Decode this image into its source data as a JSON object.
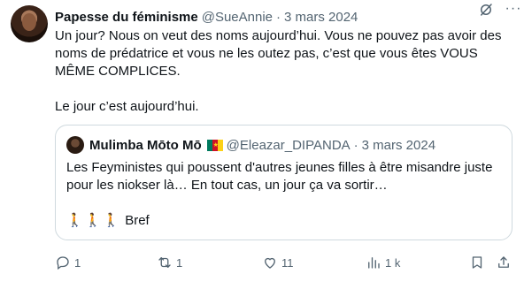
{
  "tweet": {
    "display_name": "Papesse du féminisme",
    "handle": "@SueAnnie",
    "separator": "·",
    "date": "3 mars 2024",
    "more_label": "···",
    "text_line1": "Un jour? Nous on veut des noms aujourd’hui. Vous ne pouvez pas avoir des noms de prédatrice et vous ne les outez pas, c’est que vous êtes VOUS MÊME COMPLICES.",
    "text_line2": "Le jour c’est aujourd’hui."
  },
  "quote": {
    "display_name": "Mulimba Mōto Mō",
    "handle": "@Eleazar_DIPANDA",
    "separator": "·",
    "date": "3 mars 2024",
    "flag_colors": [
      "#007a5e",
      "#ce1126",
      "#fcd116"
    ],
    "text_line1": "Les Feyministes qui poussent d'autres jeunes filles à être misandre juste pour les niokser là… En tout cas, un jour ça va sortir…",
    "walkers": "🚶🚶🚶",
    "text_line2": "Bref"
  },
  "actions": {
    "reply_count": "1",
    "repost_count": "1",
    "like_count": "11",
    "views_count": "1 k"
  },
  "colors": {
    "text": "#0f1419",
    "muted": "#536471",
    "border": "#cfd9de"
  },
  "icons": [
    "grok-icon",
    "more-icon",
    "reply-icon",
    "repost-icon",
    "like-icon",
    "views-icon",
    "bookmark-icon",
    "share-icon"
  ]
}
